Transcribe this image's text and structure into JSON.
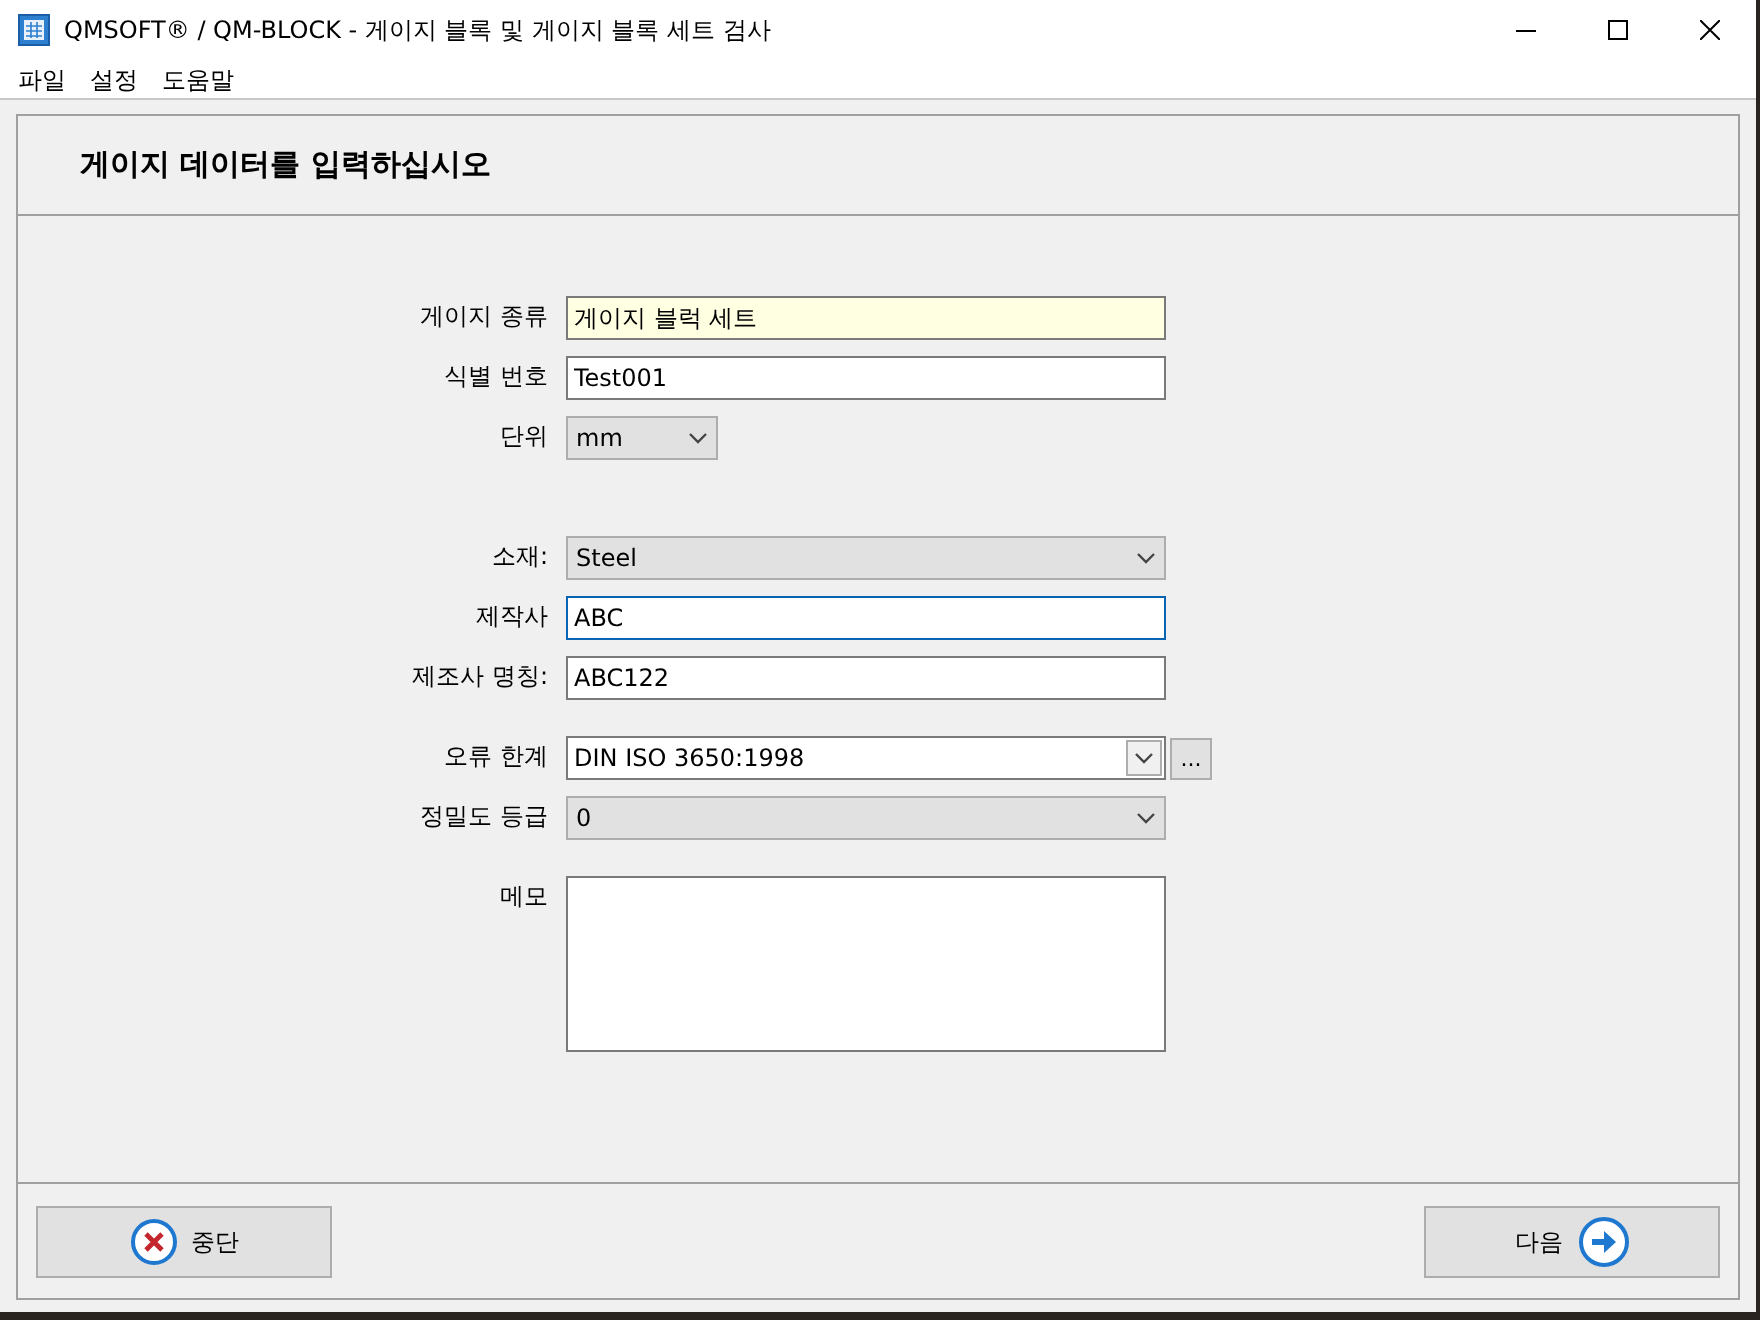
{
  "window": {
    "title": "QMSOFT® / QM-BLOCK - 게이지 블록 및 게이지 블록 세트 검사"
  },
  "menu": [
    "파일",
    "설정",
    "도움말"
  ],
  "heading": "게이지 데이터를 입력하십시오",
  "groups": [
    [
      {
        "label": "게이지 종류",
        "kind": "text",
        "value": "게이지 블럭 세트",
        "highlighted": true,
        "focused": false
      },
      {
        "label": "식별 번호",
        "kind": "text",
        "value": "Test001",
        "highlighted": false,
        "focused": false
      },
      {
        "label": "단위",
        "kind": "short_dropdown",
        "value": "mm"
      }
    ],
    [
      {
        "label": "소재:",
        "kind": "dropdown",
        "value": "Steel"
      },
      {
        "label": "제작사",
        "kind": "text",
        "value": "ABC",
        "highlighted": false,
        "focused": true
      },
      {
        "label": "제조사 명칭:",
        "kind": "text",
        "value": "ABC122",
        "highlighted": false,
        "focused": false
      }
    ],
    [
      {
        "label": "오류 한계",
        "kind": "combo",
        "value": "DIN ISO 3650:1998",
        "browse": "..."
      },
      {
        "label": "정밀도 등급",
        "kind": "dropdown",
        "value": "0"
      }
    ],
    [
      {
        "label": "메모",
        "kind": "memo"
      }
    ]
  ],
  "buttons": [
    {
      "label": "중단",
      "kind": "cancel"
    },
    {
      "label": "다음",
      "kind": "next"
    }
  ]
}
